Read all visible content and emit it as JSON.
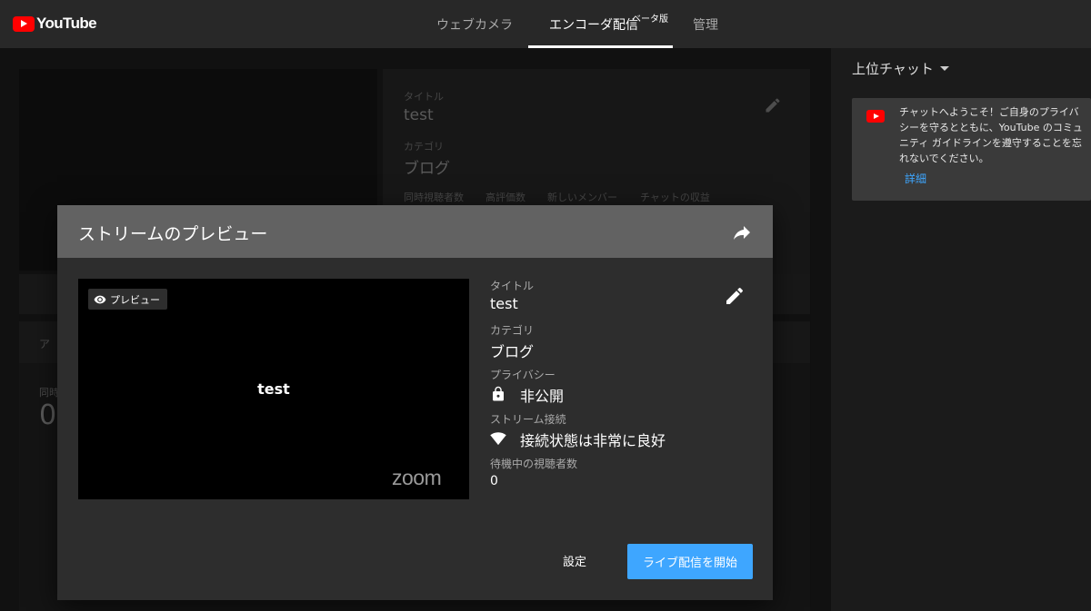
{
  "app": {
    "logo_text": "YouTube",
    "brand_color": "#ff0000",
    "accent_color": "#3ea6ff"
  },
  "tabs": [
    {
      "label": "ウェブカメラ",
      "active": false
    },
    {
      "label": "エンコーダ配信",
      "active": true,
      "badge": "ベータ版"
    },
    {
      "label": "管理",
      "active": false
    }
  ],
  "background": {
    "title_label": "タイトル",
    "title_value": "test",
    "category_label": "カテゴリ",
    "category_value": "ブログ",
    "stats": [
      "同時視聴者数",
      "高評価数",
      "新しいメンバー",
      "チャットの収益"
    ],
    "fragments": {
      "section": "ア",
      "stat_label": "同時",
      "stat_value": "0"
    }
  },
  "chat": {
    "title": "上位チャット",
    "welcome_text": "チャットへようこそ！ご自身のプライバシーを守るとともに、YouTube のコミュニティ ガイドラインを遵守することを忘れないでください。",
    "details_link": "詳細"
  },
  "modal": {
    "title": "ストリームのプレビュー",
    "preview_chip": "プレビュー",
    "video_text": "test",
    "watermark": "zoom",
    "fields": {
      "title_label": "タイトル",
      "title_value": "test",
      "category_label": "カテゴリ",
      "category_value": "ブログ",
      "privacy_label": "プライバシー",
      "privacy_value": "非公開",
      "connection_label": "ストリーム接続",
      "connection_value": "接続状態は非常に良好",
      "waiting_label": "待機中の視聴者数",
      "waiting_value": "0"
    },
    "settings_button": "設定",
    "start_button": "ライブ配信を開始"
  },
  "icons": {
    "share": "share-icon",
    "edit": "pencil-icon",
    "eye": "eye-icon",
    "lock": "lock-icon",
    "wifi": "wifi-icon",
    "dropdown": "caret-down-icon"
  }
}
